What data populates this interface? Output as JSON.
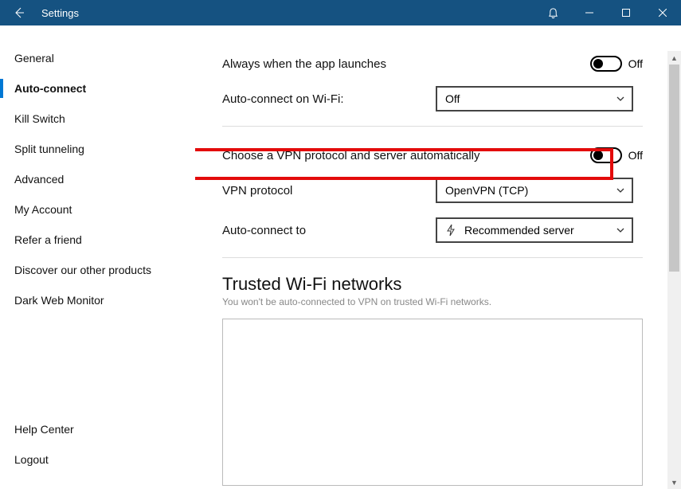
{
  "titlebar": {
    "title": "Settings"
  },
  "sidebar": {
    "items": [
      {
        "label": "General"
      },
      {
        "label": "Auto-connect",
        "active": true
      },
      {
        "label": "Kill Switch"
      },
      {
        "label": "Split tunneling"
      },
      {
        "label": "Advanced"
      },
      {
        "label": "My Account"
      },
      {
        "label": "Refer a friend"
      },
      {
        "label": "Discover our other products"
      },
      {
        "label": "Dark Web Monitor"
      }
    ],
    "bottom": [
      {
        "label": "Help Center"
      },
      {
        "label": "Logout"
      }
    ]
  },
  "content": {
    "row_launch": {
      "label": "Always when the app launches",
      "toggle_state": "Off"
    },
    "row_wifi": {
      "label": "Auto-connect on Wi-Fi:",
      "select_value": "Off"
    },
    "row_auto_proto": {
      "label": "Choose a VPN protocol and server automatically",
      "toggle_state": "Off"
    },
    "row_vpn_proto": {
      "label": "VPN protocol",
      "select_value": "OpenVPN (TCP)"
    },
    "row_connect_to": {
      "label": "Auto-connect to",
      "select_value": "Recommended server"
    },
    "trusted": {
      "title": "Trusted Wi-Fi networks",
      "subtitle": "You won't be auto-connected to VPN on trusted Wi-Fi networks."
    }
  }
}
